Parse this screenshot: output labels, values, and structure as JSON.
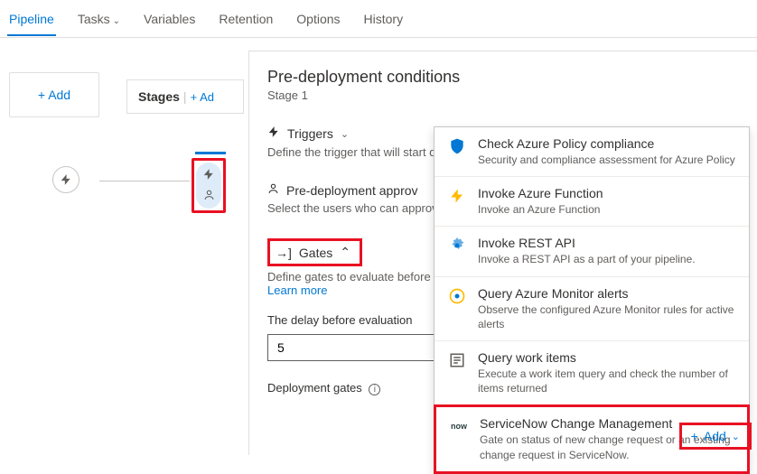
{
  "tabs": {
    "pipeline": "Pipeline",
    "tasks": "Tasks",
    "variables": "Variables",
    "retention": "Retention",
    "options": "Options",
    "history": "History"
  },
  "left": {
    "add": "Add",
    "stages": "Stages",
    "stages_add": "Ad"
  },
  "panel": {
    "title": "Pre-deployment conditions",
    "stage": "Stage 1",
    "triggers": {
      "label": "Triggers",
      "desc": "Define the trigger that will start dep"
    },
    "approvals": {
      "label": "Pre-deployment approv",
      "desc": "Select the users who can approve or"
    },
    "gates": {
      "label": "Gates",
      "desc": "Define gates to evaluate before the",
      "learn": "Learn more"
    },
    "delay_label": "The delay before evaluation",
    "delay_value": "5",
    "dep_gates": "Deployment gates"
  },
  "dropdown": {
    "items": [
      {
        "icon": "shield",
        "title": "Check Azure Policy compliance",
        "desc": "Security and compliance assessment for Azure Policy"
      },
      {
        "icon": "bolt",
        "title": "Invoke Azure Function",
        "desc": "Invoke an Azure Function"
      },
      {
        "icon": "gear",
        "title": "Invoke REST API",
        "desc": "Invoke a REST API as a part of your pipeline."
      },
      {
        "icon": "chart",
        "title": "Query Azure Monitor alerts",
        "desc": "Observe the configured Azure Monitor rules for active alerts"
      },
      {
        "icon": "query",
        "title": "Query work items",
        "desc": "Execute a work item query and check the number of items returned"
      },
      {
        "icon": "now",
        "title": "ServiceNow Change Management",
        "desc": "Gate on status of new change request or an existing change request in ServiceNow."
      }
    ]
  },
  "addbtn": {
    "label": "Add"
  }
}
